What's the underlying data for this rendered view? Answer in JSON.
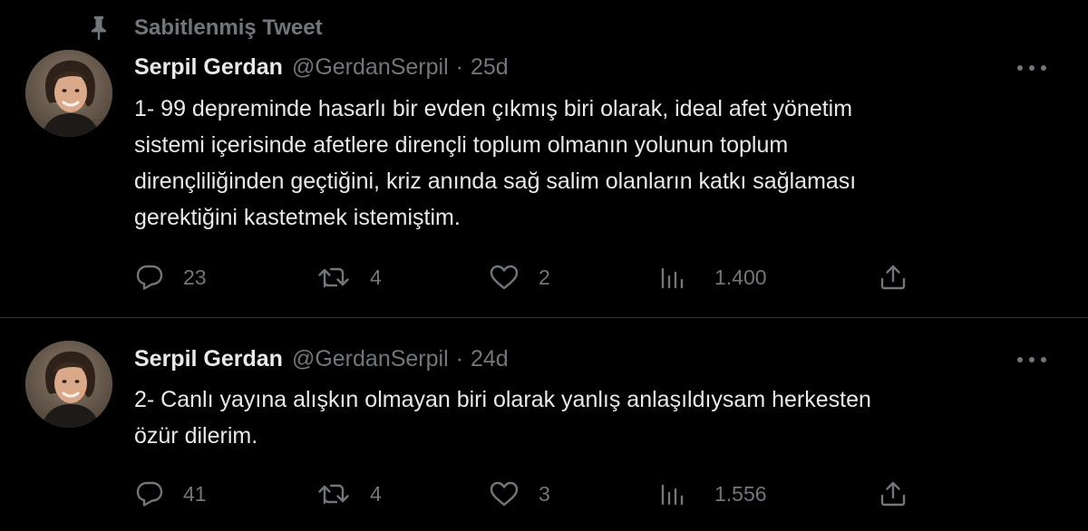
{
  "pinned": {
    "label": "Sabitlenmiş Tweet",
    "icon": "pin-icon"
  },
  "tweets": [
    {
      "author_name": "Serpil Gerdan",
      "handle": "@GerdanSerpil",
      "separator": "·",
      "time": "25d",
      "text_lines": [
        "1- 99 depreminde hasarlı bir evden çıkmış biri olarak, ideal afet yönetim",
        "sistemi içerisinde afetlere dirençli toplum olmanın yolunun toplum",
        "dirençliliğinden geçtiğini, kriz anında sağ salim olanların katkı sağlaması",
        "gerektiğini kastetmek istemiştim."
      ],
      "replies": "23",
      "retweets": "4",
      "likes": "2",
      "views": "1.400"
    },
    {
      "author_name": "Serpil Gerdan",
      "handle": "@GerdanSerpil",
      "separator": "·",
      "time": "24d",
      "text_lines": [
        "2- Canlı yayına alışkın olmayan biri olarak yanlış anlaşıldıysam herkesten",
        "özür dilerim."
      ],
      "replies": "41",
      "retweets": "4",
      "likes": "3",
      "views": "1.556"
    }
  ],
  "icons": {
    "reply": "reply-icon",
    "retweet": "retweet-icon",
    "like": "heart-icon",
    "views": "views-icon",
    "share": "share-icon",
    "more": "more-icon"
  },
  "colors": {
    "background": "#000000",
    "text_primary": "#e7e9ea",
    "text_secondary": "#71767b",
    "divider": "#2f3336"
  }
}
